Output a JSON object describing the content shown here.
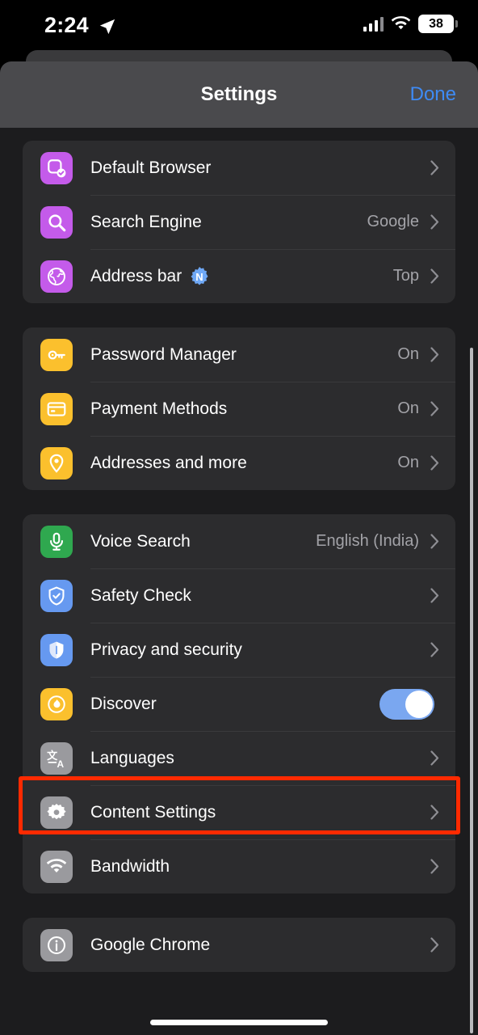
{
  "status_bar": {
    "time": "2:24",
    "location_icon": "location-arrow-icon",
    "signal_icon": "cellular-signal-icon",
    "wifi_icon": "wifi-icon",
    "battery_level": "38"
  },
  "sheet": {
    "title": "Settings",
    "done_label": "Done"
  },
  "groups": [
    {
      "id": "browser-group",
      "rows": [
        {
          "label": "Default Browser",
          "value": "",
          "icon": "default-browser-icon",
          "icon_color": "#C45BEA",
          "accessory": "chevron"
        },
        {
          "label": "Search Engine",
          "value": "Google",
          "icon": "search-icon",
          "icon_color": "#C45BEA",
          "accessory": "chevron"
        },
        {
          "label": "Address bar",
          "value": "Top",
          "icon": "globe-icon",
          "icon_color": "#C45BEA",
          "accessory": "chevron",
          "badge": "N"
        }
      ]
    },
    {
      "id": "autofill-group",
      "rows": [
        {
          "label": "Password Manager",
          "value": "On",
          "icon": "key-icon",
          "icon_color": "#FBC02D",
          "accessory": "chevron"
        },
        {
          "label": "Payment Methods",
          "value": "On",
          "icon": "credit-card-icon",
          "icon_color": "#FBC02D",
          "accessory": "chevron"
        },
        {
          "label": "Addresses and more",
          "value": "On",
          "icon": "location-pin-icon",
          "icon_color": "#FBC02D",
          "accessory": "chevron"
        }
      ]
    },
    {
      "id": "features-group",
      "rows": [
        {
          "label": "Voice Search",
          "value": "English (India)",
          "icon": "microphone-icon",
          "icon_color": "#2FA84F",
          "accessory": "chevron"
        },
        {
          "label": "Safety Check",
          "value": "",
          "icon": "shield-check-icon",
          "icon_color": "#6699F0",
          "accessory": "chevron"
        },
        {
          "label": "Privacy and security",
          "value": "",
          "icon": "shield-icon",
          "icon_color": "#6699F0",
          "accessory": "chevron"
        },
        {
          "label": "Discover",
          "value": "",
          "icon": "flame-icon",
          "icon_color": "#FBC02D",
          "accessory": "toggle",
          "toggle_on": true
        },
        {
          "label": "Languages",
          "value": "",
          "icon": "translate-icon",
          "icon_color": "#9A9A9E",
          "accessory": "chevron"
        },
        {
          "label": "Content Settings",
          "value": "",
          "icon": "gear-icon",
          "icon_color": "#9A9A9E",
          "accessory": "chevron",
          "highlighted": true
        },
        {
          "label": "Bandwidth",
          "value": "",
          "icon": "wifi-icon",
          "icon_color": "#9A9A9E",
          "accessory": "chevron"
        }
      ]
    },
    {
      "id": "about-group",
      "rows": [
        {
          "label": "Google Chrome",
          "value": "",
          "icon": "info-icon",
          "icon_color": "#9A9A9E",
          "accessory": "chevron"
        }
      ]
    }
  ],
  "highlight": {
    "target": "Content Settings",
    "color": "#FF2A00"
  },
  "home_indicator": "home-indicator"
}
